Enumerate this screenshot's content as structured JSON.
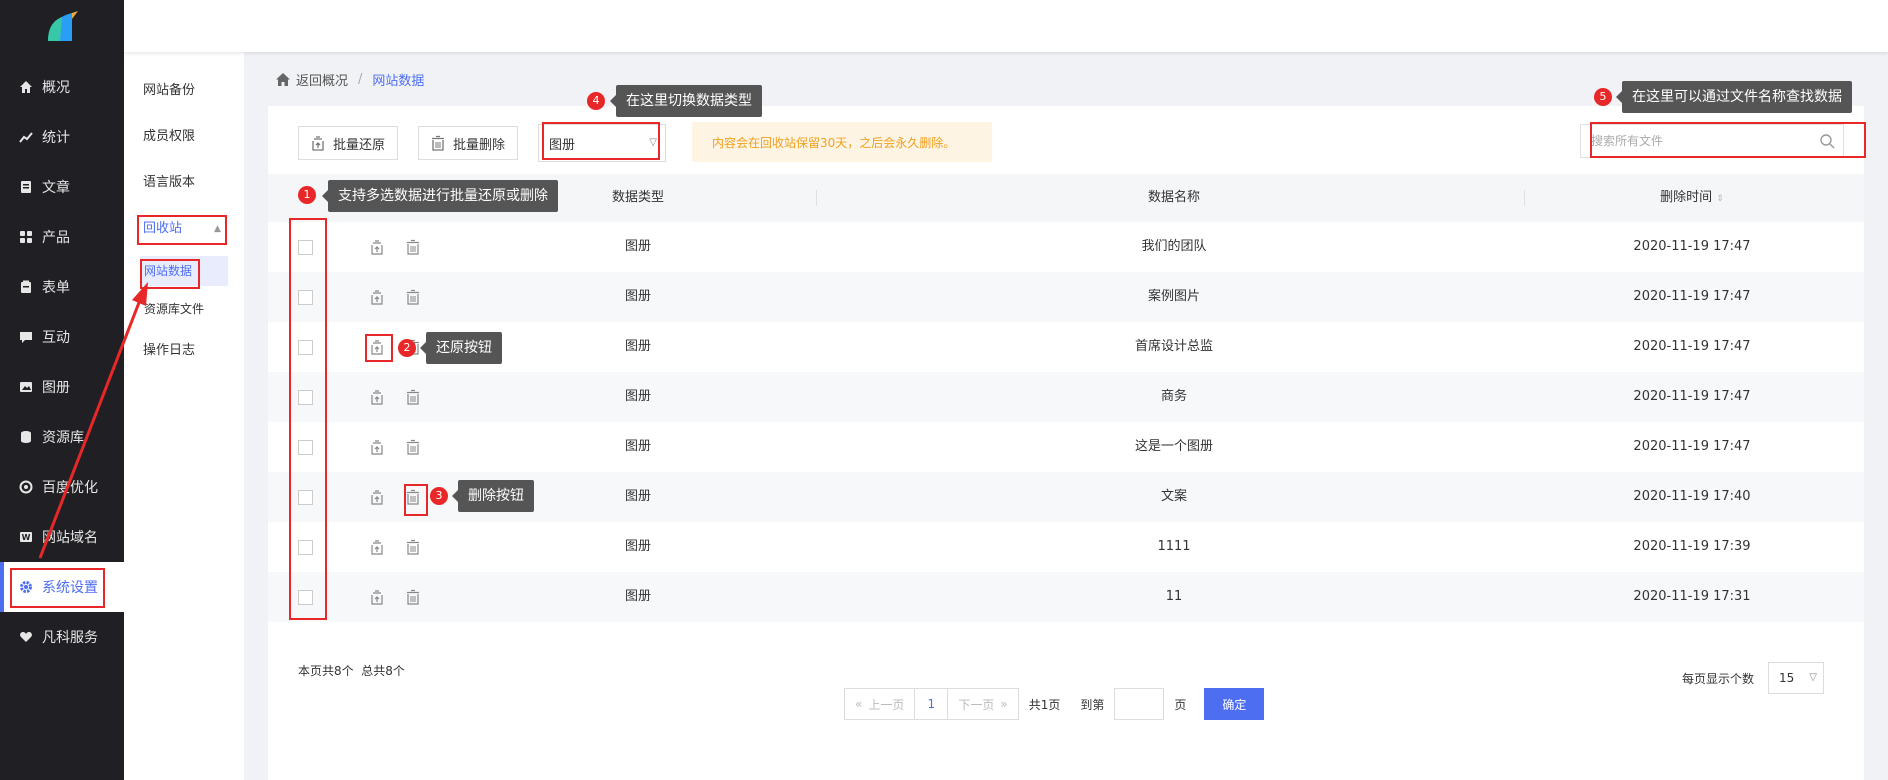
{
  "sidebar": {
    "items": [
      {
        "label": "概况",
        "icon": "home-icon"
      },
      {
        "label": "统计",
        "icon": "chart-icon"
      },
      {
        "label": "文章",
        "icon": "article-icon"
      },
      {
        "label": "产品",
        "icon": "grid-icon"
      },
      {
        "label": "表单",
        "icon": "form-icon"
      },
      {
        "label": "互动",
        "icon": "chat-icon"
      },
      {
        "label": "图册",
        "icon": "album-icon"
      },
      {
        "label": "资源库",
        "icon": "database-icon"
      },
      {
        "label": "百度优化",
        "icon": "target-icon"
      },
      {
        "label": "网站域名",
        "icon": "w-icon"
      },
      {
        "label": "系统设置",
        "icon": "gear-icon"
      },
      {
        "label": "凡科服务",
        "icon": "heart-icon"
      }
    ]
  },
  "submenu": {
    "items": [
      "网站备份",
      "成员权限",
      "语言版本"
    ],
    "recycle": "回收站",
    "recycle_children": [
      "网站数据",
      "资源库文件"
    ],
    "log": "操作日志"
  },
  "breadcrumb": {
    "back": "返回概况",
    "sep": "/",
    "current": "网站数据"
  },
  "toolbar": {
    "batch_restore": "批量还原",
    "batch_delete": "批量删除",
    "type_select": "图册",
    "notice": "内容会在回收站保留30天，之后会永久删除。",
    "search_placeholder": "搜索所有文件"
  },
  "table": {
    "headers": {
      "type": "数据类型",
      "name": "数据名称",
      "time": "删除时间",
      "sort_icon": "sort-icon"
    },
    "rows": [
      {
        "type": "图册",
        "name": "我们的团队",
        "time": "2020-11-19 17:47"
      },
      {
        "type": "图册",
        "name": "案例图片",
        "time": "2020-11-19 17:47"
      },
      {
        "type": "图册",
        "name": "首席设计总监",
        "time": "2020-11-19 17:47"
      },
      {
        "type": "图册",
        "name": "商务",
        "time": "2020-11-19 17:47"
      },
      {
        "type": "图册",
        "name": "这是一个图册",
        "time": "2020-11-19 17:47"
      },
      {
        "type": "图册",
        "name": "文案",
        "time": "2020-11-19 17:40"
      },
      {
        "type": "图册",
        "name": "1111",
        "time": "2020-11-19 17:39"
      },
      {
        "type": "图册",
        "name": "11",
        "time": "2020-11-19 17:31"
      }
    ]
  },
  "footer": {
    "page_count": "本页共8个",
    "total_count": "总共8个",
    "prev": "上一页",
    "page": "1",
    "next": "下一页",
    "total_pages": "共1页",
    "goto": "到第",
    "page_unit": "页",
    "confirm": "确定",
    "per_page_label": "每页显示个数",
    "per_page": "15"
  },
  "annotations": {
    "tip1": "支持多选数据进行批量还原或删除",
    "tip2": "还原按钮",
    "tip3": "删除按钮",
    "tip4": "在这里切换数据类型",
    "tip5": "在这里可以通过文件名称查找数据",
    "n1": "1",
    "n2": "2",
    "n3": "3",
    "n4": "4",
    "n5": "5"
  },
  "colors": {
    "accent": "#4e6ef2",
    "annotation": "#e82828",
    "sidebar": "#1f1f24",
    "notice": "#f0a020"
  }
}
